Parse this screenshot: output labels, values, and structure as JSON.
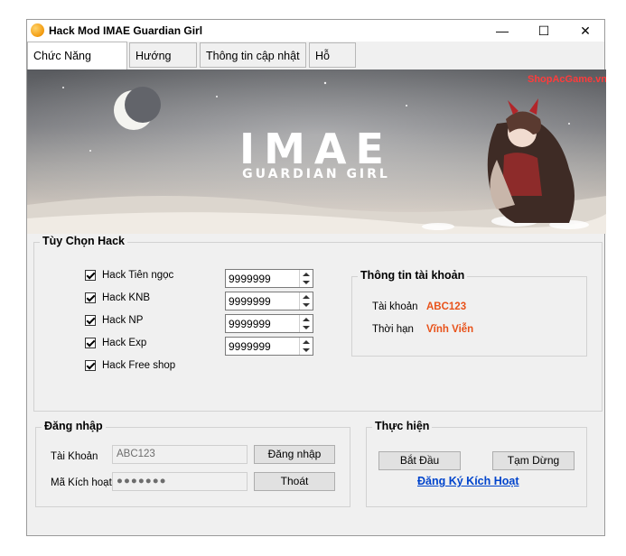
{
  "window": {
    "title": "Hack Mod IMAE Guardian Girl",
    "minimize": "—",
    "maximize": "☐",
    "close": "✕"
  },
  "tabs": [
    {
      "label": "Chức Năng Chính"
    },
    {
      "label": "Hướng Dẫn"
    },
    {
      "label": "Thông tin cập nhật"
    },
    {
      "label": "Hỗ Trợ"
    }
  ],
  "banner": {
    "watermark": "ShopAcGame.vn",
    "logo_main": "IMAE",
    "logo_sub": "GUARDIAN GIRL"
  },
  "hack_options": {
    "legend": "Tùy Chọn Hack",
    "items": [
      {
        "label": "Hack Tiên ngọc",
        "value": "9999999"
      },
      {
        "label": "Hack KNB",
        "value": "9999999"
      },
      {
        "label": "Hack NP",
        "value": "9999999"
      },
      {
        "label": "Hack Exp",
        "value": "9999999"
      },
      {
        "label": "Hack Free shop"
      }
    ]
  },
  "account_info": {
    "legend": "Thông tin tài khoản",
    "account_label": "Tài khoản",
    "account_value": "ABC123",
    "expiry_label": "Thời hạn",
    "expiry_value": "Vĩnh Viễn"
  },
  "login": {
    "legend": "Đăng nhập",
    "account_label": "Tài Khoản",
    "account_value": "ABC123",
    "code_label": "Mã Kích hoạt",
    "code_value": "●●●●●●●",
    "login_button": "Đăng nhập",
    "exit_button": "Thoát"
  },
  "actions": {
    "legend": "Thực hiện",
    "start_button": "Bắt Đầu",
    "pause_button": "Tạm Dừng",
    "register_link": "Đăng Ký Kích Hoạt"
  },
  "colors": {
    "accent_orange": "#e8521a",
    "link_blue": "#0044cc"
  }
}
